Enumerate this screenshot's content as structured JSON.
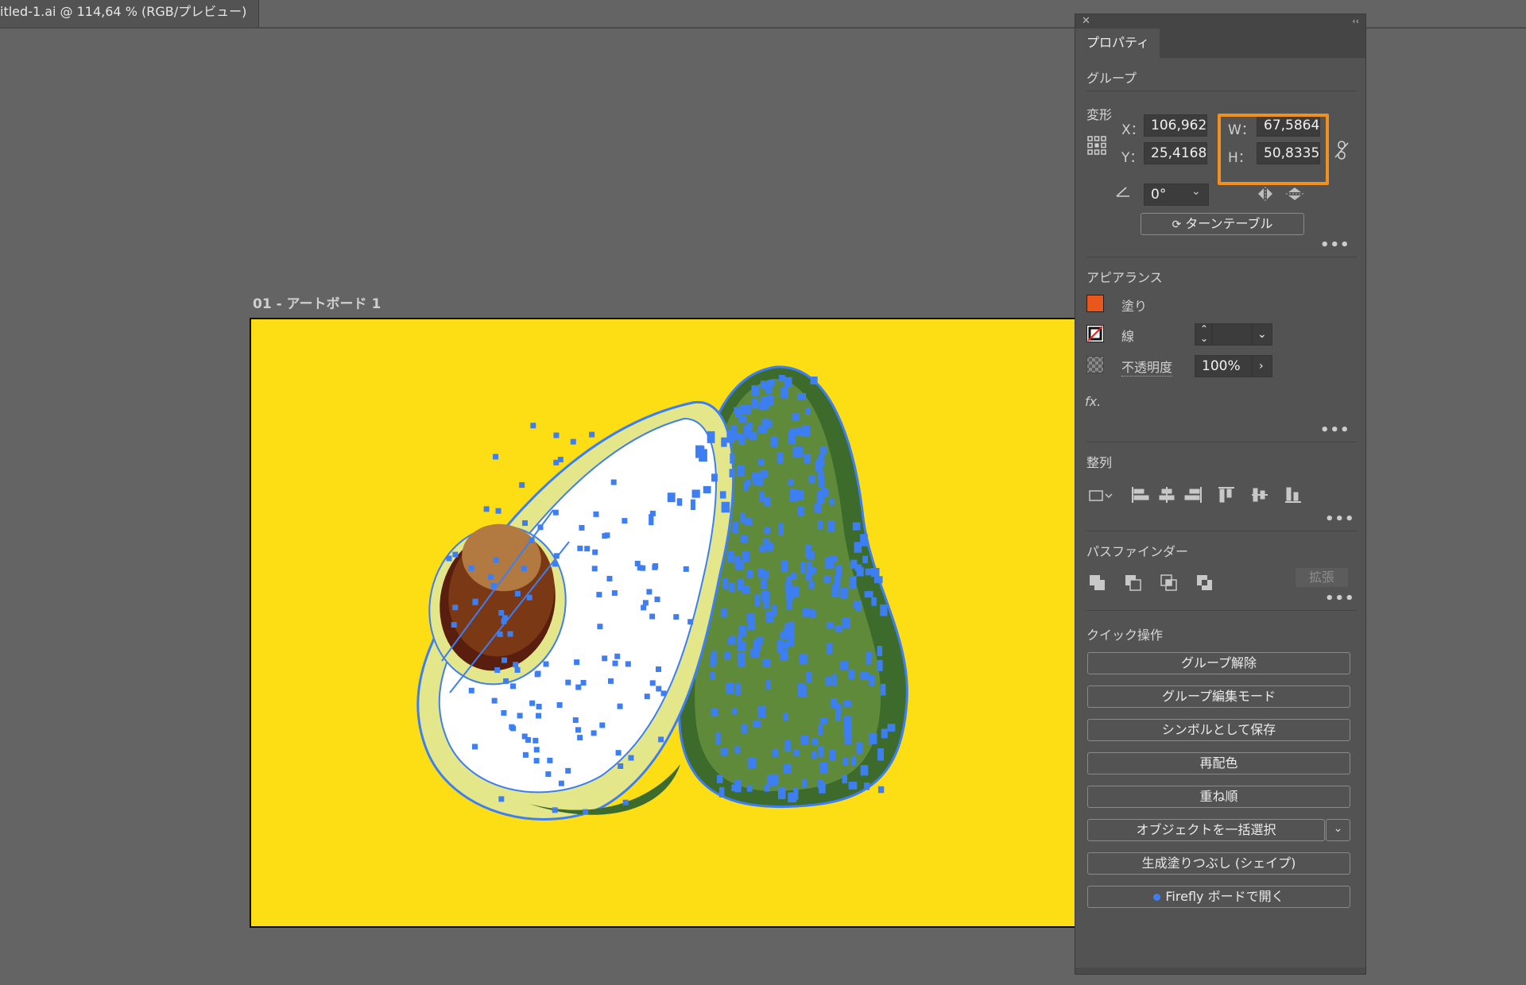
{
  "document": {
    "tab_title": "itled-1.ai @ 114,64 % (RGB/プレビュー)",
    "artboard_label": "01 - アートボード 1"
  },
  "colors": {
    "canvas_bg": "#646464",
    "artboard_fill": "#FDDD13",
    "selection": "#3D7FF2",
    "highlight": "#F0901F",
    "fill_swatch": "#E8571C"
  },
  "panel": {
    "tab": "プロパティ",
    "close_icon": "close-icon",
    "collapse_icon": "double-chevron-icon",
    "selection_type": "グループ",
    "transform": {
      "title": "変形",
      "x_label": "X：",
      "x_value": "106,962",
      "y_label": "Y：",
      "y_value": "25,4168",
      "w_label": "W：",
      "w_value": "67,5864",
      "h_label": "H：",
      "h_value": "50,8335",
      "angle_value": "0°",
      "turntable_label": "ターンテーブル"
    },
    "appearance": {
      "title": "アピアランス",
      "fill_label": "塗り",
      "stroke_label": "線",
      "opacity_label": "不透明度",
      "opacity_value": "100%",
      "fx_label": "fx."
    },
    "align": {
      "title": "整列"
    },
    "pathfinder": {
      "title": "パスファインダー",
      "expand_label": "拡張"
    },
    "quick_actions": {
      "title": "クイック操作",
      "buttons": [
        "グループ解除",
        "グループ編集モード",
        "シンボルとして保存",
        "再配色",
        "重ね順",
        "オブジェクトを一括選択",
        "生成塗りつぶし (シェイプ)",
        "Firefly ボードで開く"
      ]
    }
  }
}
